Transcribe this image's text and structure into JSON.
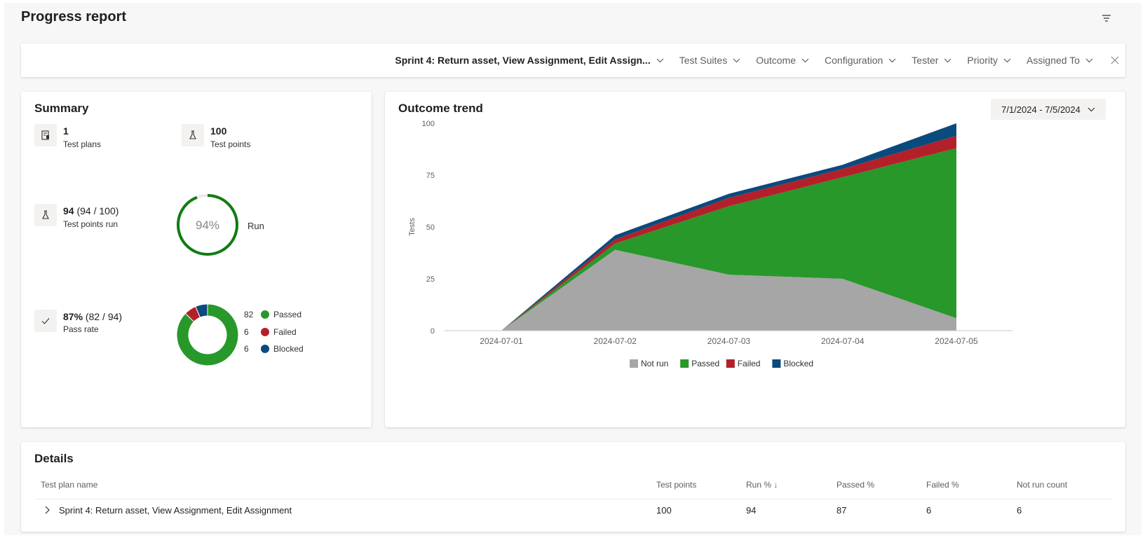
{
  "header": {
    "title": "Progress report",
    "filter_icon": "filter-icon"
  },
  "filter_bar": {
    "items": [
      {
        "label": "Sprint 4: Return asset, View Assignment, Edit Assign...",
        "strong": true
      },
      {
        "label": "Test Suites"
      },
      {
        "label": "Outcome"
      },
      {
        "label": "Configuration"
      },
      {
        "label": "Tester"
      },
      {
        "label": "Priority"
      },
      {
        "label": "Assigned To"
      }
    ],
    "close_icon": "close-icon"
  },
  "summary": {
    "title": "Summary",
    "test_plans": {
      "value": "1",
      "label": "Test plans",
      "icon": "test-plan-icon"
    },
    "test_points": {
      "value": "100",
      "label": "Test points",
      "icon": "flask-icon"
    },
    "test_points_run": {
      "value": "94",
      "detail": "(94 / 100)",
      "label": "Test points run",
      "icon": "flask-icon"
    },
    "run_donut": {
      "percent_text": "94%",
      "label": "Run",
      "fraction": 0.94
    },
    "pass_rate": {
      "value": "87%",
      "detail": "(82 / 94)",
      "label": "Pass rate",
      "icon": "checkmark-icon"
    },
    "outcome_donut": {
      "legend": [
        {
          "count": "82",
          "label": "Passed",
          "value": 82
        },
        {
          "count": "6",
          "label": "Failed",
          "value": 6
        },
        {
          "count": "6",
          "label": "Blocked",
          "value": 6
        }
      ]
    }
  },
  "colors": {
    "not_run": "#a6a6a6",
    "passed": "#28982b",
    "failed": "#b4202a",
    "blocked": "#0b4a7d",
    "run_ring": "#107c10",
    "run_track": "#edebe9"
  },
  "trend": {
    "title": "Outcome trend",
    "date_range": "7/1/2024 - 7/5/2024"
  },
  "chart_data": {
    "type": "area",
    "stacked": true,
    "title": "Outcome trend",
    "ylabel": "Tests",
    "ylim": [
      0,
      100
    ],
    "yticks": [
      0,
      25,
      50,
      75,
      100
    ],
    "x": [
      "2024-07-01",
      "2024-07-02",
      "2024-07-03",
      "2024-07-04",
      "2024-07-05"
    ],
    "series": [
      {
        "name": "Not run",
        "color": "#a6a6a6",
        "values": [
          0,
          39,
          27,
          25,
          6
        ]
      },
      {
        "name": "Passed",
        "color": "#28982b",
        "values": [
          0,
          3,
          33,
          49,
          82
        ]
      },
      {
        "name": "Failed",
        "color": "#b4202a",
        "values": [
          0,
          2,
          4,
          4,
          6
        ]
      },
      {
        "name": "Blocked",
        "color": "#0b4a7d",
        "values": [
          0,
          2,
          2,
          2,
          6
        ]
      }
    ],
    "grid": false,
    "legend_position": "bottom"
  },
  "details": {
    "title": "Details",
    "columns": [
      "Test plan name",
      "Test points",
      "Run % ↓",
      "Passed %",
      "Failed %",
      "Not run count"
    ],
    "rows": [
      [
        "Sprint 4: Return asset, View Assignment, Edit Assignment",
        "100",
        "94",
        "87",
        "6",
        "6"
      ]
    ]
  }
}
